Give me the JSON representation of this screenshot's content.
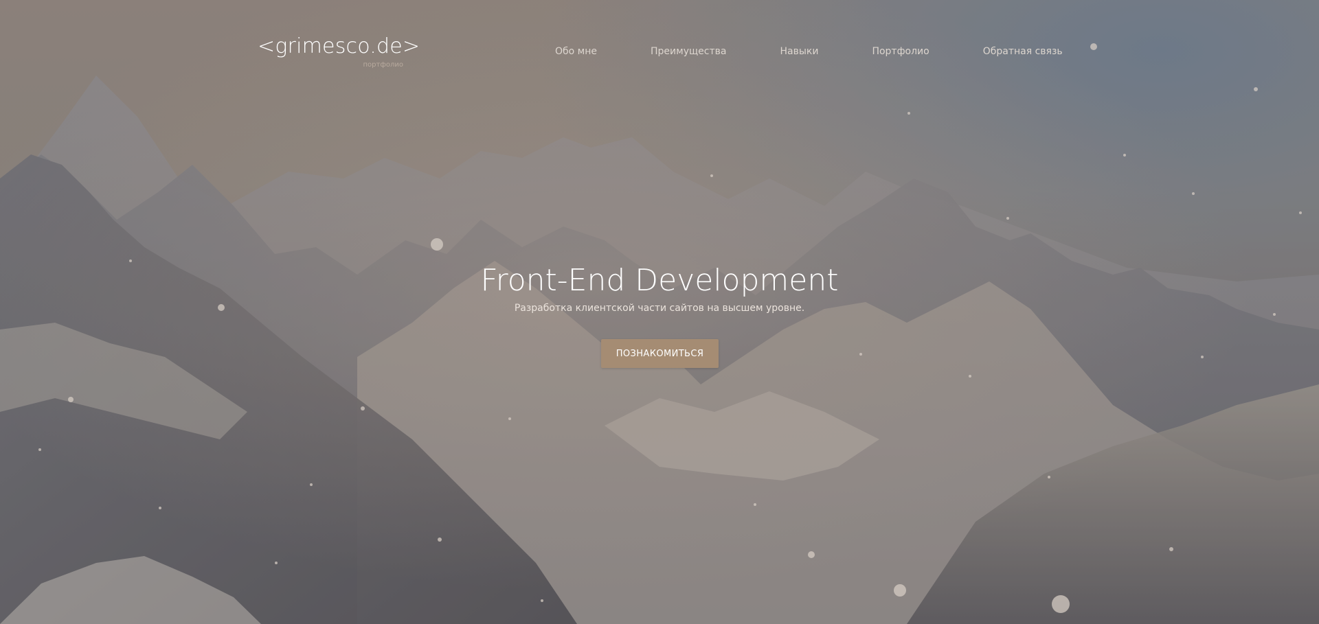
{
  "header": {
    "logo_text": "<grimesco.de>",
    "logo_subtitle": "портфолио"
  },
  "nav": {
    "items": [
      {
        "label": "Обо мне"
      },
      {
        "label": "Преимущества"
      },
      {
        "label": "Навыки"
      },
      {
        "label": "Портфолио"
      },
      {
        "label": "Обратная связь"
      }
    ]
  },
  "hero": {
    "title": "Front-End Development",
    "subtitle": "Разработка клиентской части сайтов на высшем уровне.",
    "cta_label": "ПОЗНАКОМИТЬСЯ"
  },
  "colors": {
    "accent": "#a58c73",
    "text_primary": "#ffffff",
    "nav_text": "#ddd6cf"
  }
}
